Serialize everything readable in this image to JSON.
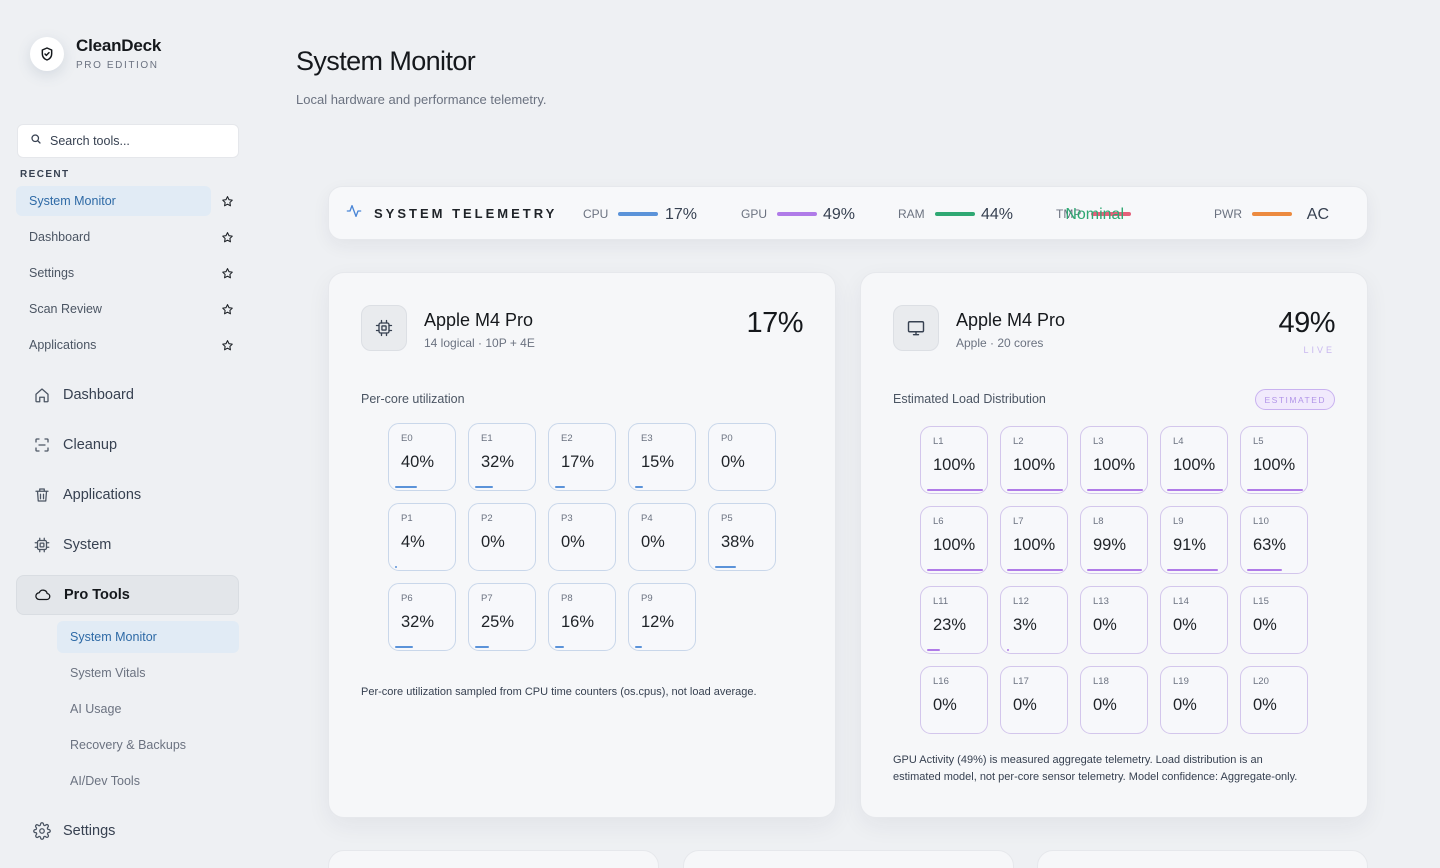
{
  "brand": {
    "name": "CleanDeck",
    "edition": "PRO EDITION"
  },
  "search": {
    "placeholder": "Search tools..."
  },
  "recent": {
    "label": "RECENT",
    "items": [
      {
        "label": "System Monitor",
        "active": true
      },
      {
        "label": "Dashboard"
      },
      {
        "label": "Settings"
      },
      {
        "label": "Scan Review"
      },
      {
        "label": "Applications"
      }
    ]
  },
  "nav": {
    "items": [
      {
        "label": "Dashboard",
        "icon": "home-icon"
      },
      {
        "label": "Cleanup",
        "icon": "scan-icon"
      },
      {
        "label": "Applications",
        "icon": "trash-icon"
      },
      {
        "label": "System",
        "icon": "chip-icon"
      },
      {
        "label": "Pro Tools",
        "icon": "cloud-icon",
        "expanded": true
      }
    ],
    "sub_items": [
      {
        "label": "System Monitor",
        "active": true
      },
      {
        "label": "System Vitals"
      },
      {
        "label": "AI Usage"
      },
      {
        "label": "Recovery & Backups"
      },
      {
        "label": "AI/Dev Tools"
      }
    ],
    "settings": {
      "label": "Settings",
      "icon": "gear-icon"
    }
  },
  "page": {
    "title": "System Monitor",
    "subtitle": "Local hardware and performance telemetry."
  },
  "telemetry": {
    "title": "SYSTEM TELEMETRY",
    "metrics": [
      {
        "label": "CPU",
        "value": "17%",
        "color": "#5b93d9"
      },
      {
        "label": "GPU",
        "value": "49%",
        "color": "#b07be8"
      },
      {
        "label": "RAM",
        "value": "44%",
        "color": "#2fa873"
      },
      {
        "label": "TMP",
        "value": "Nominal",
        "color": "#e5607a",
        "value_color": "#2fa873"
      },
      {
        "label": "PWR",
        "value": "AC",
        "color": "#ec8a3f"
      }
    ]
  },
  "cpu_card": {
    "title": "Apple M4 Pro",
    "subtitle": "14 logical · 10P + 4E",
    "value": "17%",
    "section": "Per-core utilization",
    "cores": [
      {
        "name": "E0",
        "value": "40%",
        "pct": 40
      },
      {
        "name": "E1",
        "value": "32%",
        "pct": 32
      },
      {
        "name": "E2",
        "value": "17%",
        "pct": 17
      },
      {
        "name": "E3",
        "value": "15%",
        "pct": 15
      },
      {
        "name": "P0",
        "value": "0%",
        "pct": 0
      },
      {
        "name": "P1",
        "value": "4%",
        "pct": 4
      },
      {
        "name": "P2",
        "value": "0%",
        "pct": 0
      },
      {
        "name": "P3",
        "value": "0%",
        "pct": 0
      },
      {
        "name": "P4",
        "value": "0%",
        "pct": 0
      },
      {
        "name": "P5",
        "value": "38%",
        "pct": 38
      },
      {
        "name": "P6",
        "value": "32%",
        "pct": 32
      },
      {
        "name": "P7",
        "value": "25%",
        "pct": 25
      },
      {
        "name": "P8",
        "value": "16%",
        "pct": 16
      },
      {
        "name": "P9",
        "value": "12%",
        "pct": 12
      }
    ],
    "footnote": "Per-core utilization sampled from CPU time counters (os.cpus), not load average."
  },
  "gpu_card": {
    "title": "Apple M4 Pro",
    "subtitle": "Apple · 20 cores",
    "value": "49%",
    "live_label": "LIVE",
    "section": "Estimated Load Distribution",
    "badge": "ESTIMATED",
    "cores": [
      {
        "name": "L1",
        "value": "100%",
        "pct": 100
      },
      {
        "name": "L2",
        "value": "100%",
        "pct": 100
      },
      {
        "name": "L3",
        "value": "100%",
        "pct": 100
      },
      {
        "name": "L4",
        "value": "100%",
        "pct": 100
      },
      {
        "name": "L5",
        "value": "100%",
        "pct": 100
      },
      {
        "name": "L6",
        "value": "100%",
        "pct": 100
      },
      {
        "name": "L7",
        "value": "100%",
        "pct": 100
      },
      {
        "name": "L8",
        "value": "99%",
        "pct": 99
      },
      {
        "name": "L9",
        "value": "91%",
        "pct": 91
      },
      {
        "name": "L10",
        "value": "63%",
        "pct": 63
      },
      {
        "name": "L11",
        "value": "23%",
        "pct": 23
      },
      {
        "name": "L12",
        "value": "3%",
        "pct": 3
      },
      {
        "name": "L13",
        "value": "0%",
        "pct": 0
      },
      {
        "name": "L14",
        "value": "0%",
        "pct": 0
      },
      {
        "name": "L15",
        "value": "0%",
        "pct": 0
      },
      {
        "name": "L16",
        "value": "0%",
        "pct": 0
      },
      {
        "name": "L17",
        "value": "0%",
        "pct": 0
      },
      {
        "name": "L18",
        "value": "0%",
        "pct": 0
      },
      {
        "name": "L19",
        "value": "0%",
        "pct": 0
      },
      {
        "name": "L20",
        "value": "0%",
        "pct": 0
      }
    ],
    "footnote_line1": "GPU Activity (49%) is measured aggregate telemetry. Load distribution is an",
    "footnote_line2": "estimated model, not per-core sensor telemetry. Model confidence: Aggregate-only."
  }
}
